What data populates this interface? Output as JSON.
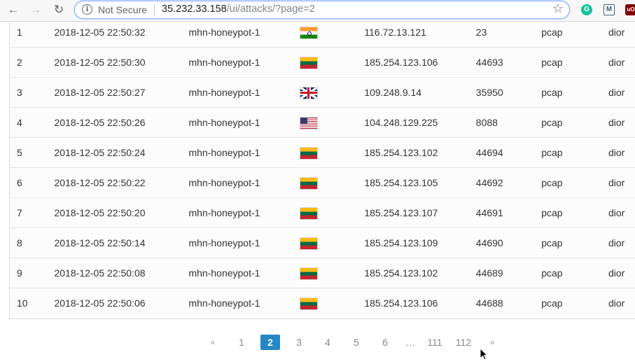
{
  "browser": {
    "back_icon": "←",
    "forward_icon": "→",
    "reload_icon": "↻",
    "security_label": "Not Secure",
    "url_host": "35.232.33.158",
    "url_path": "/ui/attacks/?page=2",
    "star_icon": "☆",
    "extensions": [
      {
        "name": "grammarly-extension-icon",
        "glyph": "G"
      },
      {
        "name": "mendeley-extension-icon",
        "glyph": "M"
      },
      {
        "name": "ublock-extension-icon",
        "glyph": "uO"
      }
    ]
  },
  "colors": {
    "accent": "#2488c8",
    "url_focus": "#8ab4f8"
  },
  "attacks": [
    {
      "num": "1",
      "date": "2018-12-05 22:50:32",
      "sensor": "mhn-honeypot-1",
      "flag": "in",
      "ip": "116.72.13.121",
      "port": "23",
      "protocol": "pcap",
      "user": "dior"
    },
    {
      "num": "2",
      "date": "2018-12-05 22:50:30",
      "sensor": "mhn-honeypot-1",
      "flag": "lt",
      "ip": "185.254.123.106",
      "port": "44693",
      "protocol": "pcap",
      "user": "dior"
    },
    {
      "num": "3",
      "date": "2018-12-05 22:50:27",
      "sensor": "mhn-honeypot-1",
      "flag": "gb",
      "ip": "109.248.9.14",
      "port": "35950",
      "protocol": "pcap",
      "user": "dior"
    },
    {
      "num": "4",
      "date": "2018-12-05 22:50:26",
      "sensor": "mhn-honeypot-1",
      "flag": "us",
      "ip": "104.248.129.225",
      "port": "8088",
      "protocol": "pcap",
      "user": "dior"
    },
    {
      "num": "5",
      "date": "2018-12-05 22:50:24",
      "sensor": "mhn-honeypot-1",
      "flag": "lt",
      "ip": "185.254.123.102",
      "port": "44694",
      "protocol": "pcap",
      "user": "dior"
    },
    {
      "num": "6",
      "date": "2018-12-05 22:50:22",
      "sensor": "mhn-honeypot-1",
      "flag": "lt",
      "ip": "185.254.123.105",
      "port": "44692",
      "protocol": "pcap",
      "user": "dior"
    },
    {
      "num": "7",
      "date": "2018-12-05 22:50:20",
      "sensor": "mhn-honeypot-1",
      "flag": "lt",
      "ip": "185.254.123.107",
      "port": "44691",
      "protocol": "pcap",
      "user": "dior"
    },
    {
      "num": "8",
      "date": "2018-12-05 22:50:14",
      "sensor": "mhn-honeypot-1",
      "flag": "lt",
      "ip": "185.254.123.109",
      "port": "44690",
      "protocol": "pcap",
      "user": "dior"
    },
    {
      "num": "9",
      "date": "2018-12-05 22:50:08",
      "sensor": "mhn-honeypot-1",
      "flag": "lt",
      "ip": "185.254.123.102",
      "port": "44689",
      "protocol": "pcap",
      "user": "dior"
    },
    {
      "num": "10",
      "date": "2018-12-05 22:50:06",
      "sensor": "mhn-honeypot-1",
      "flag": "lt",
      "ip": "185.254.123.106",
      "port": "44688",
      "protocol": "pcap",
      "user": "dior"
    }
  ],
  "pagination": {
    "prev_label": "«",
    "next_label": "»",
    "ellipsis": "…",
    "current": "2",
    "pages": [
      "1",
      "2",
      "3",
      "4",
      "5",
      "6",
      "…",
      "111",
      "112"
    ]
  }
}
